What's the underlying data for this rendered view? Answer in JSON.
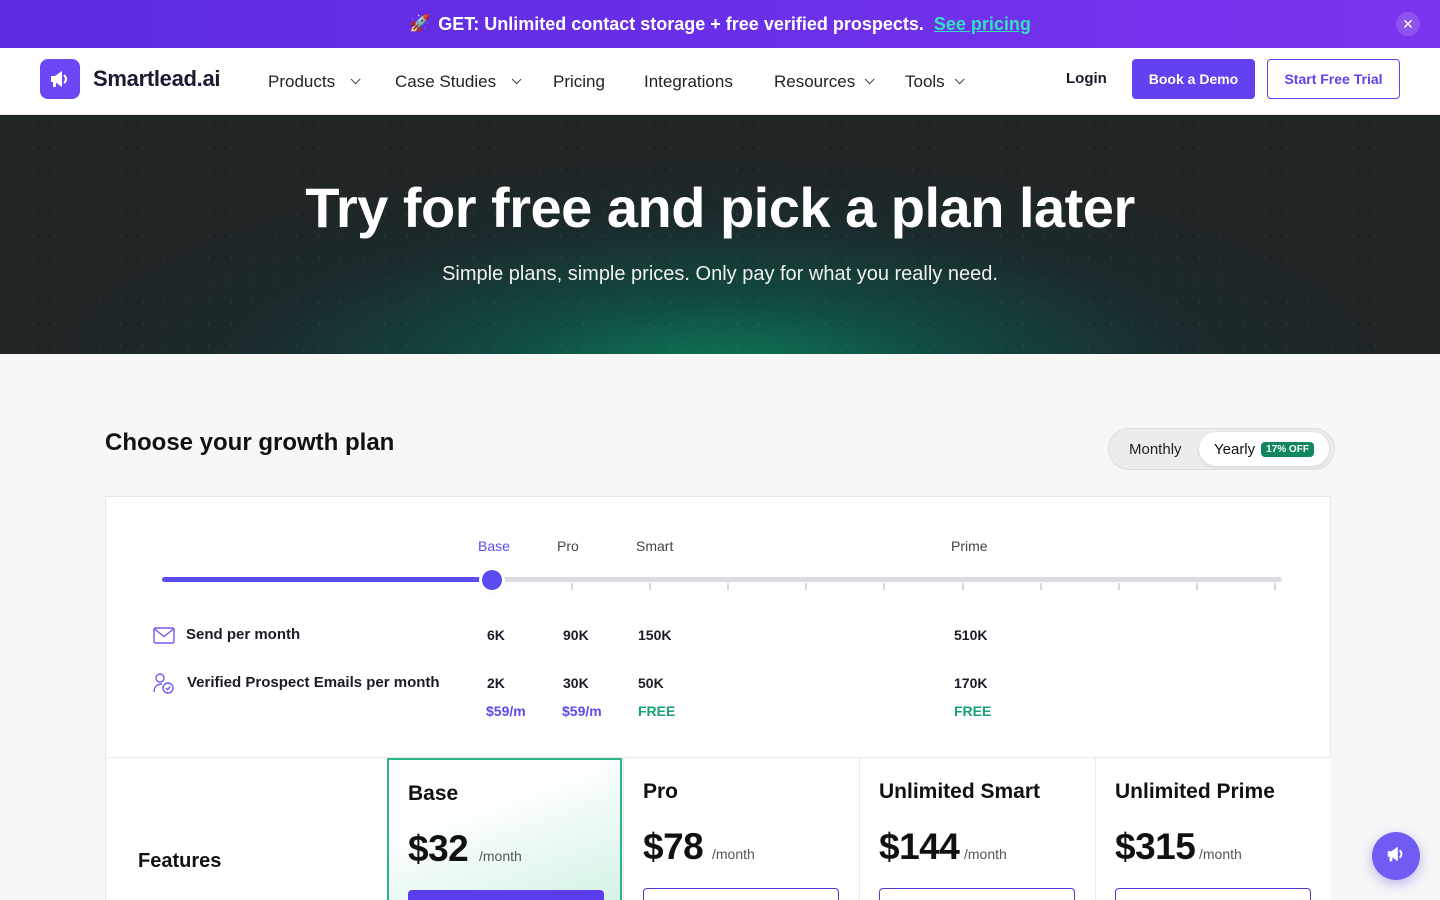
{
  "announcement": {
    "rocket": "🚀",
    "text": "GET: Unlimited contact storage + free verified prospects.",
    "link": "See pricing",
    "close": "✕"
  },
  "nav": {
    "logo_text": "Smartlead.ai",
    "items": [
      {
        "label": "Products",
        "dropdown": true
      },
      {
        "label": "Case Studies",
        "dropdown": true
      },
      {
        "label": "Pricing",
        "dropdown": false
      },
      {
        "label": "Integrations",
        "dropdown": false
      },
      {
        "label": "Resources",
        "dropdown": true
      },
      {
        "label": "Tools",
        "dropdown": true
      }
    ],
    "login": "Login",
    "demo": "Book a Demo",
    "trial": "Start Free Trial"
  },
  "hero": {
    "title": "Try for free and pick a plan later",
    "subtitle": "Simple plans, simple prices. Only pay for what you really need."
  },
  "plans_section": {
    "title": "Choose your growth plan",
    "billing": {
      "monthly": "Monthly",
      "yearly": "Yearly",
      "discount": "17% OFF",
      "selected": "Yearly"
    },
    "slider": {
      "selected_tier": "Base",
      "tiers": [
        "Base",
        "Pro",
        "Smart",
        "Prime"
      ],
      "level": 0.295
    },
    "rows": {
      "send_label": "Send per month",
      "send_values": [
        "6K",
        "90K",
        "150K",
        "510K"
      ],
      "verified_label": "Verified Prospect Emails per month",
      "verified_values": [
        "2K",
        "30K",
        "50K",
        "170K"
      ],
      "verified_prices": [
        "$59/m",
        "$59/m",
        "FREE",
        "FREE"
      ]
    },
    "features_label": "Features",
    "plans": [
      {
        "name": "Base",
        "price": "$32",
        "per": "/month"
      },
      {
        "name": "Pro",
        "price": "$78",
        "per": "/month"
      },
      {
        "name": "Unlimited Smart",
        "price": "$144",
        "per": "/month"
      },
      {
        "name": "Unlimited Prime",
        "price": "$315",
        "per": "/month"
      }
    ]
  },
  "colors": {
    "accent": "#5b4cf0",
    "brand": "#6b47f5",
    "free": "#16a274",
    "highlight_border": "#2bb68a"
  },
  "icons": [
    "close-icon",
    "logo-icon",
    "chevron-down-icon",
    "mail-icon",
    "user-check-icon",
    "megaphone-icon"
  ]
}
